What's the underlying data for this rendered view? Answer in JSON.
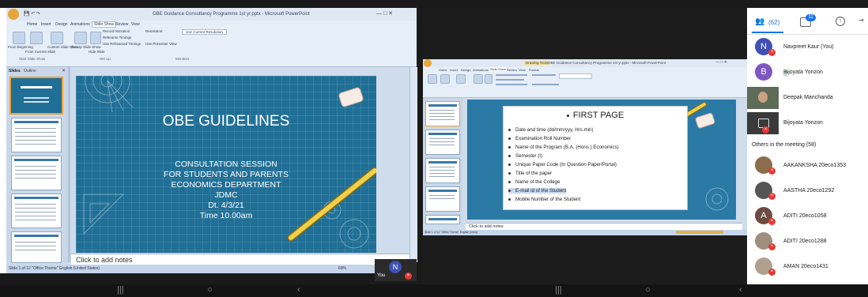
{
  "left_window": {
    "title": "OBE Guidance Consultancy Programme 1st yr.pptx - Microsoft PowerPoint",
    "tabs": [
      "Home",
      "Insert",
      "Design",
      "Animations",
      "Slide Show",
      "Review",
      "View"
    ],
    "ribbon_items": [
      "From Beginning",
      "From Current Slide",
      "Custom Slide Show",
      "Set Up Slide Show",
      "Hide Slide",
      "Record Narration",
      "Rehearse Timings",
      "Use Rehearsed Timings",
      "Resolution:",
      "Use Current Resolution",
      "Use Presenter View"
    ],
    "ribbon_groups": [
      "Start Slide Show",
      "Set Up",
      "Monitors"
    ],
    "pane_tabs": [
      "Slides",
      "Outline"
    ],
    "slide": {
      "title": "OBE GUIDELINES",
      "lines": [
        "CONSULTATION SESSION",
        "FOR STUDENTS AND PARENTS",
        "ECONOMICS DEPARTMENT",
        "JDMC",
        "Dt. 4/3/21",
        "Time 10.00am"
      ]
    },
    "notes_placeholder": "Click to add notes",
    "status_left": "Slide 1 of 12   \"Office Theme\"   English (United States)",
    "zoom": "69%",
    "self_label": "You",
    "self_initial": "N"
  },
  "right_window": {
    "title": "OBE Guidance Consultancy Programme 1st yr.pptx - Microsoft PowerPoint",
    "drawing_tools": "Drawing Tools",
    "tabs": [
      "Home",
      "Insert",
      "Design",
      "Animations",
      "Slide Show",
      "Review",
      "View",
      "Format"
    ],
    "slide_title": "FIRST PAGE",
    "bullets": [
      "Date and time (dd/mm/yyy, Hrs.min)",
      "Examination Roll Number",
      "Name of the Program (B.A. (Hons.) Economics)",
      "Semester (I)",
      "Unique Paper Code (In Question Paper/Portal)",
      "Title of the paper",
      "Name of the College",
      "E-mail id of the Student",
      "Mobile Number of the Student"
    ],
    "notes_placeholder": "Click to add notes",
    "status_left": "Slide 1 of 12   \"Office Theme\"   English (India)"
  },
  "panel": {
    "people_count": "(62)",
    "chat_badge": "11",
    "in_call": [
      {
        "initial": "N",
        "name": "Navpreet Kaur (You)",
        "color": "#3f51b5",
        "mic": "off"
      },
      {
        "initial": "B",
        "name": "Bijoyata Yonzon",
        "color": "#7e57c2",
        "mic": "on"
      },
      {
        "initial": "",
        "name": "Deepak Manchanda",
        "color": "#5d6b57",
        "mic": "none"
      },
      {
        "initial": "",
        "name": "Bijoyata Yonzon",
        "color": "#3a3a3a",
        "mic": "off"
      }
    ],
    "others_heading": "Others in the meeting (58)",
    "others": [
      {
        "initial": "",
        "name": "AAKANKSHA 20eco1353",
        "color": "#8a6d4b"
      },
      {
        "initial": "",
        "name": "AASTHA 20eco1292",
        "color": "#555555"
      },
      {
        "initial": "A",
        "name": "ADITI 20eco1058",
        "color": "#6d4c41"
      },
      {
        "initial": "",
        "name": "ADITI 20eco1288",
        "color": "#9e8f7e"
      },
      {
        "initial": "",
        "name": "AMAN 20eco1431",
        "color": "#b0a090"
      }
    ],
    "colors": {
      "accent": "#1a73e8",
      "mic_off": "#e53935",
      "mic_on": "#34a853"
    }
  }
}
